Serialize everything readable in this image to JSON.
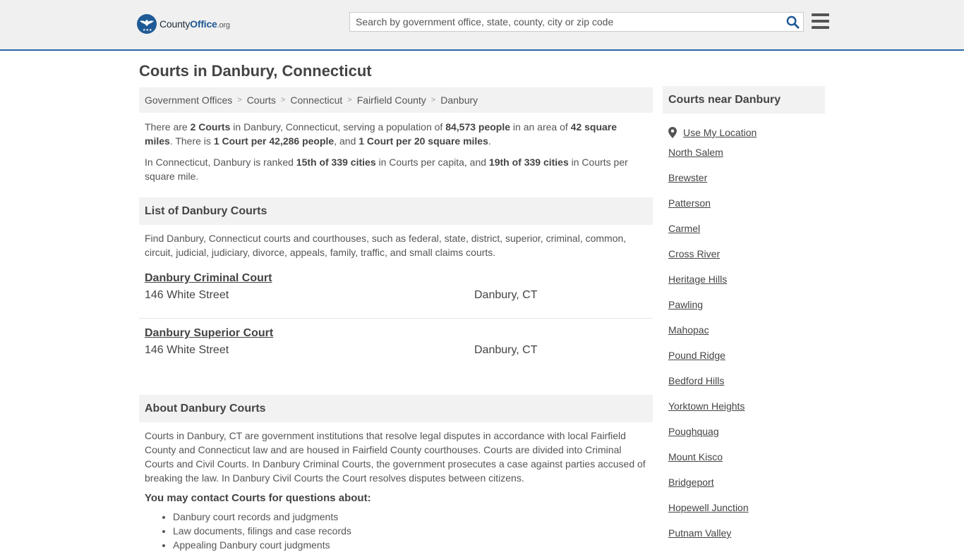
{
  "header": {
    "logo": {
      "part1": "County",
      "part2": "Office",
      "part3": ".org"
    },
    "search_placeholder": "Search by government office, state, county, city or zip code"
  },
  "page_title": "Courts in Danbury, Connecticut",
  "breadcrumb": [
    "Government Offices",
    "Courts",
    "Connecticut",
    "Fairfield County",
    "Danbury"
  ],
  "intro": {
    "p1": [
      {
        "t": "There are "
      },
      {
        "t": "2 Courts",
        "b": true
      },
      {
        "t": " in Danbury, Connecticut, serving a population of "
      },
      {
        "t": "84,573 people",
        "b": true
      },
      {
        "t": " in an area of "
      },
      {
        "t": "42 square miles",
        "b": true
      },
      {
        "t": ". There is "
      },
      {
        "t": "1 Court per 42,286 people",
        "b": true
      },
      {
        "t": ", and "
      },
      {
        "t": "1 Court per 20 square miles",
        "b": true
      },
      {
        "t": "."
      }
    ],
    "p2": [
      {
        "t": "In Connecticut, Danbury is ranked "
      },
      {
        "t": "15th of 339 cities",
        "b": true
      },
      {
        "t": " in Courts per capita, and "
      },
      {
        "t": "19th of 339 cities",
        "b": true
      },
      {
        "t": " in Courts per square mile."
      }
    ]
  },
  "list_section": {
    "heading": "List of Danbury Courts",
    "description": "Find Danbury, Connecticut courts and courthouses, such as federal, state, district, superior, criminal, common, circuit, judicial, judiciary, divorce, appeals, family, traffic, and small claims courts.",
    "courts": [
      {
        "name": "Danbury Criminal Court",
        "address": "146 White Street",
        "city": "Danbury, CT"
      },
      {
        "name": "Danbury Superior Court",
        "address": "146 White Street",
        "city": "Danbury, CT"
      }
    ]
  },
  "about_section": {
    "heading": "About Danbury Courts",
    "text": "Courts in Danbury, CT are government institutions that resolve legal disputes in accordance with local Fairfield County and Connecticut law and are housed in Fairfield County courthouses. Courts are divided into Criminal Courts and Civil Courts. In Danbury Criminal Courts, the government prosecutes a case against parties accused of breaking the law. In Danbury Civil Courts the Court resolves disputes between citizens.",
    "contact_heading": "You may contact Courts for questions about:",
    "contact_items": [
      "Danbury court records and judgments",
      "Law documents, filings and case records",
      "Appealing Danbury court judgments"
    ]
  },
  "sidebar": {
    "heading": "Courts near Danbury",
    "use_location": "Use My Location",
    "links": [
      "North Salem",
      "Brewster",
      "Patterson",
      "Carmel",
      "Cross River",
      "Heritage Hills",
      "Pawling",
      "Mahopac",
      "Pound Ridge",
      "Bedford Hills",
      "Yorktown Heights",
      "Poughquag",
      "Mount Kisco",
      "Bridgeport",
      "Hopewell Junction",
      "Putnam Valley"
    ]
  },
  "colors": {
    "brand_blue": "#1f5a96",
    "header_bg": "#f0f0f0",
    "header_border": "#2a65a8"
  }
}
